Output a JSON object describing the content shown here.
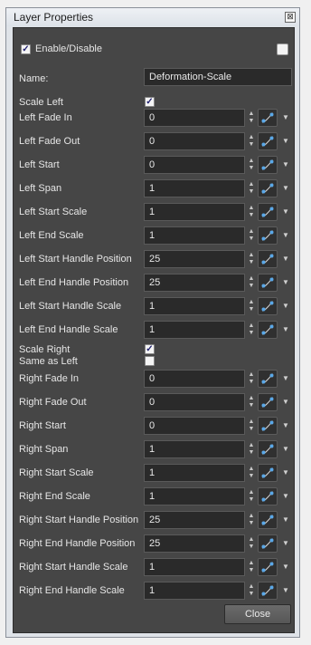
{
  "window": {
    "title": "Layer Properties",
    "close_glyph": "⊠"
  },
  "enable": {
    "label": "Enable/Disable",
    "checked": true
  },
  "name": {
    "label": "Name:",
    "value": "Deformation-Scale"
  },
  "scale_left": {
    "label": "Scale Left",
    "checked": true
  },
  "left_rows": [
    {
      "label": "Left Fade In",
      "value": "0"
    },
    {
      "label": "Left Fade Out",
      "value": "0"
    },
    {
      "label": "Left Start",
      "value": "0"
    },
    {
      "label": "Left Span",
      "value": "1"
    },
    {
      "label": "Left Start Scale",
      "value": "1"
    },
    {
      "label": "Left End Scale",
      "value": "1"
    },
    {
      "label": "Left Start Handle Position",
      "value": "25"
    },
    {
      "label": "Left End Handle Position",
      "value": "25"
    },
    {
      "label": "Left Start Handle Scale",
      "value": "1"
    },
    {
      "label": "Left End Handle Scale",
      "value": "1"
    }
  ],
  "scale_right": {
    "label": "Scale Right",
    "checked": true
  },
  "same_as_left": {
    "label": "Same as Left",
    "checked": false
  },
  "right_rows": [
    {
      "label": "Right Fade In",
      "value": "0"
    },
    {
      "label": "Right Fade Out",
      "value": "0"
    },
    {
      "label": "Right Start",
      "value": "0"
    },
    {
      "label": "Right Span",
      "value": "1"
    },
    {
      "label": "Right Start Scale",
      "value": "1"
    },
    {
      "label": "Right End Scale",
      "value": "1"
    },
    {
      "label": "Right Start Handle Position",
      "value": "25"
    },
    {
      "label": "Right End Handle Position",
      "value": "25"
    },
    {
      "label": "Right Start Handle Scale",
      "value": "1"
    },
    {
      "label": "Right End Handle Scale",
      "value": "1"
    }
  ],
  "buttons": {
    "close": "Close"
  },
  "icons": {
    "function": "function-curve-icon",
    "spinner": "spinner-arrows-icon",
    "dropdown": "chevron-down-icon"
  },
  "colors": {
    "panel_bg": "#464646",
    "field_bg": "#2a2a2a",
    "accent": "#5aa8e8"
  }
}
